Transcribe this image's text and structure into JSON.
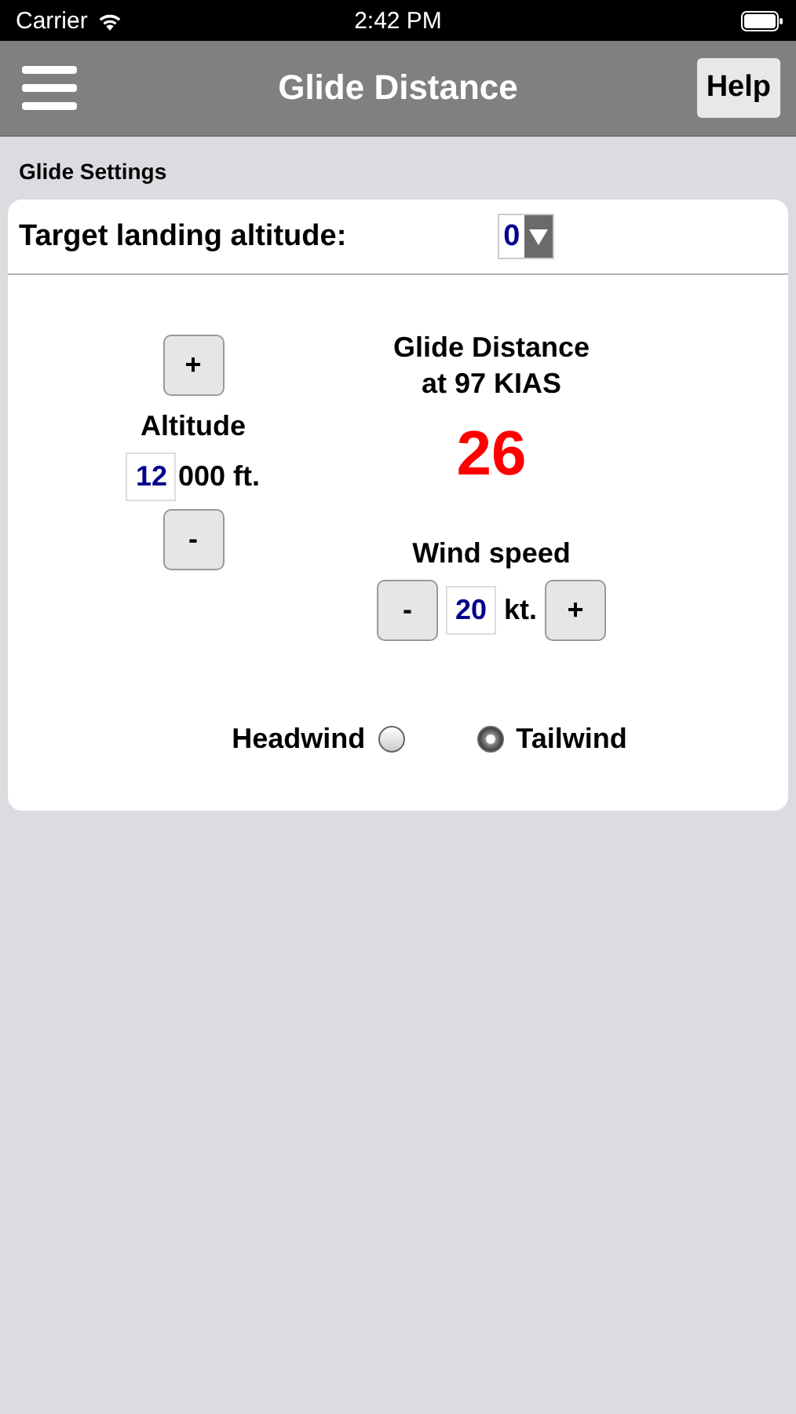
{
  "status_bar": {
    "carrier": "Carrier",
    "time": "2:42 PM"
  },
  "nav_bar": {
    "title": "Glide Distance",
    "help_button": "Help"
  },
  "section_title": "Glide Settings",
  "target_landing_altitude": {
    "label": "Target landing altitude:",
    "value": "0"
  },
  "altitude": {
    "increment": "+",
    "label": "Altitude",
    "value": "12",
    "suffix": "000 ft.",
    "decrement": "-"
  },
  "result": {
    "title": "Glide Distance",
    "subtitle": "at 97 KIAS",
    "value": "26"
  },
  "wind_speed": {
    "label": "Wind speed",
    "decrement": "-",
    "value": "20",
    "unit": "kt.",
    "increment": "+"
  },
  "wind_direction": [
    {
      "label": "Headwind",
      "selected": false
    },
    {
      "label": "Tailwind",
      "selected": true
    }
  ]
}
